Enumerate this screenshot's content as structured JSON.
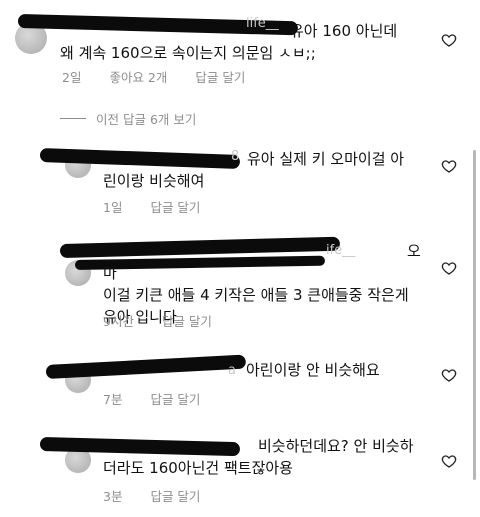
{
  "comments": [
    {
      "username_fragment": "life__",
      "text": "유아 160 아닌데\n왜 계속 160으로 속이는지 의문임 ㅅㅂ;;",
      "time": "2일",
      "likes": "좋아요 2개",
      "reply": "답글 달기"
    },
    {
      "username_fragment": "8",
      "text": "유아 실제 키 오마이걸 아\n린이랑 비슷해여",
      "time": "1일",
      "reply": "답글 달기"
    },
    {
      "username_fragment": "ife__",
      "text": "오마\n이걸 키큰 애들 4 키작은 애들 3 큰애들중 작은게\n유아 입니다",
      "time": "9시간",
      "reply": "답글 달기"
    },
    {
      "username_fragment": "a",
      "text": "아린이랑 안 비슷해요",
      "time": "7분",
      "reply": "답글 달기"
    },
    {
      "username_fragment": "",
      "text": "비슷하던데요? 안 비슷하\n더라도 160아닌건 팩트잖아용",
      "time": "3분",
      "reply": "답글 달기"
    }
  ],
  "view_replies": "이전 답글 6개 보기",
  "icons": {
    "heart": "heart-outline-icon"
  }
}
